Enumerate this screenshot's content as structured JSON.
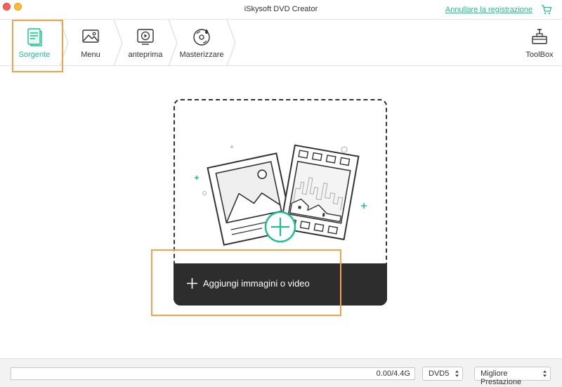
{
  "window": {
    "title": "iSkysoft DVD Creator"
  },
  "header": {
    "cancel_registration": "Annullare la registrazione",
    "cart_icon": "cart-icon"
  },
  "steps": [
    {
      "label": "Sorgente",
      "icon": "document-icon",
      "active": true
    },
    {
      "label": "Menu",
      "icon": "image-icon",
      "active": false
    },
    {
      "label": "anteprima",
      "icon": "play-icon",
      "active": false
    },
    {
      "label": "Masterizzare",
      "icon": "disc-burn-icon",
      "active": false
    }
  ],
  "toolbox": {
    "label": "ToolBox",
    "icon": "toolbox-icon"
  },
  "dropzone": {
    "add_label": "Aggiungi immagini o video",
    "add_icon": "plus-icon"
  },
  "status": {
    "size_text": "0.00/4.4G",
    "progress": 0,
    "disc_type": "DVD5",
    "quality": "Migliore Prestazione"
  },
  "colors": {
    "accent": "#1fbe8d",
    "highlight": "#f0a24d",
    "bar": "#2d2d2d"
  }
}
